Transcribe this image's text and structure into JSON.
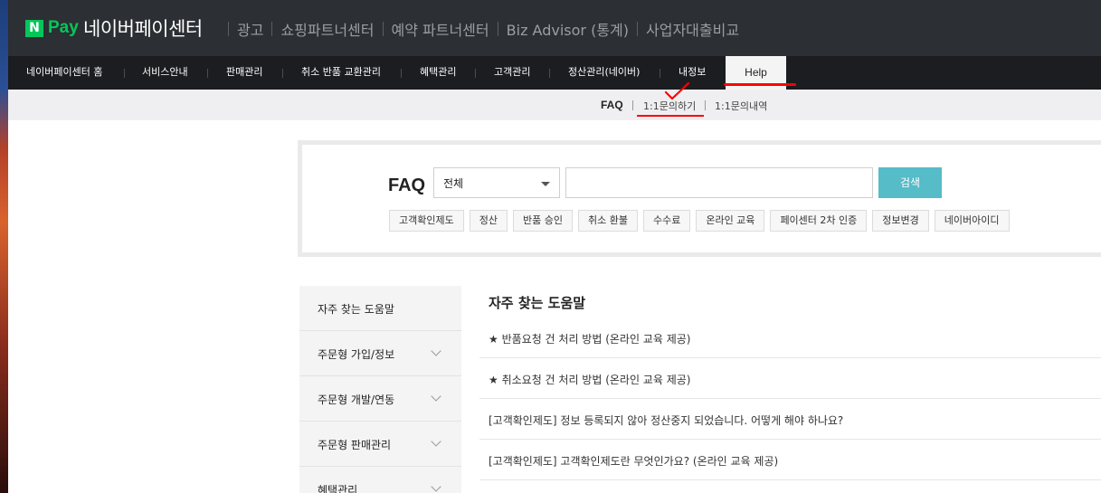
{
  "brand": {
    "logo_n": "N",
    "logo_pay": "Pay",
    "center_title": "네이버페이센터",
    "links": [
      "광고",
      "쇼핑파트너센터",
      "예약 파트너센터",
      "Biz Advisor (통계)",
      "사업자대출비교"
    ]
  },
  "nav": {
    "items": [
      "네이버페이센터 홈",
      "서비스안내",
      "판매관리",
      "취소 반품 교환관리",
      "혜택관리",
      "고객관리",
      "정산관리(네이버)",
      "내정보"
    ],
    "help": "Help"
  },
  "subnav": {
    "faq": "FAQ",
    "inquiry": "1:1문의하기",
    "history": "1:1문의내역"
  },
  "faq_search": {
    "label": "FAQ",
    "select_value": "전체",
    "query": "",
    "search_button": "검색",
    "chips": [
      "고객확인제도",
      "정산",
      "반품 승인",
      "취소 환불",
      "수수료",
      "온라인 교육",
      "페이센터 2차 인증",
      "정보변경",
      "네이버아이디"
    ]
  },
  "side_menu": {
    "heading": "자주 찾는 도움말",
    "items": [
      "주문형 가입/정보",
      "주문형 개발/연동",
      "주문형 판매관리",
      "혜택관리"
    ]
  },
  "faq_list": {
    "title": "자주 찾는 도움말",
    "items": [
      "★ 반품요청 건 처리 방법 (온라인 교육 제공)",
      "★ 취소요청 건 처리 방법 (온라인 교육 제공)",
      "[고객확인제도] 정보 등록되지 않아 정산중지 되었습니다. 어떻게 해야 하나요?",
      "[고객확인제도] 고객확인제도란 무엇인가요? (온라인 교육 제공)"
    ]
  },
  "colors": {
    "naver_green": "#03c75a",
    "search_button": "#55bcc8",
    "annotation_red": "#ff0000"
  }
}
